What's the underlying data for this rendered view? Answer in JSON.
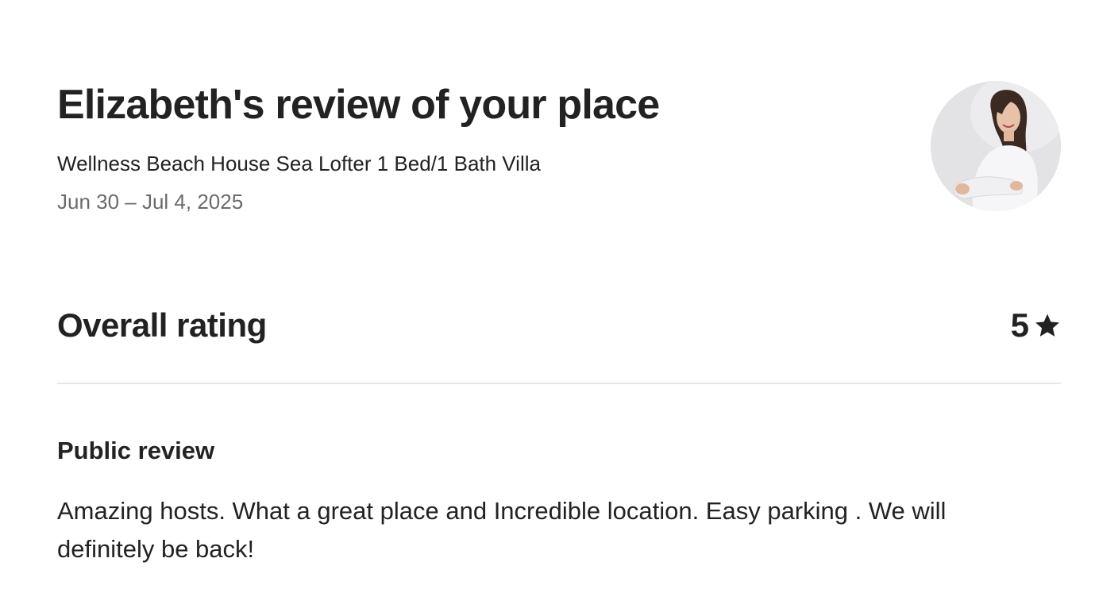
{
  "header": {
    "title": "Elizabeth's review of your place",
    "listing_name": "Wellness Beach House Sea Lofter 1 Bed/1 Bath Villa",
    "dates": "Jun 30 – Jul 4, 2025"
  },
  "rating": {
    "label": "Overall rating",
    "value": "5",
    "icon": "star-icon"
  },
  "public_review": {
    "heading": "Public review",
    "text": "Amazing hosts. What a great place and Incredible location. Easy parking . We will definitely be back!"
  },
  "colors": {
    "text_primary": "#222222",
    "text_secondary": "#6a6a6a",
    "divider": "#e6e6e6",
    "background": "#ffffff"
  }
}
